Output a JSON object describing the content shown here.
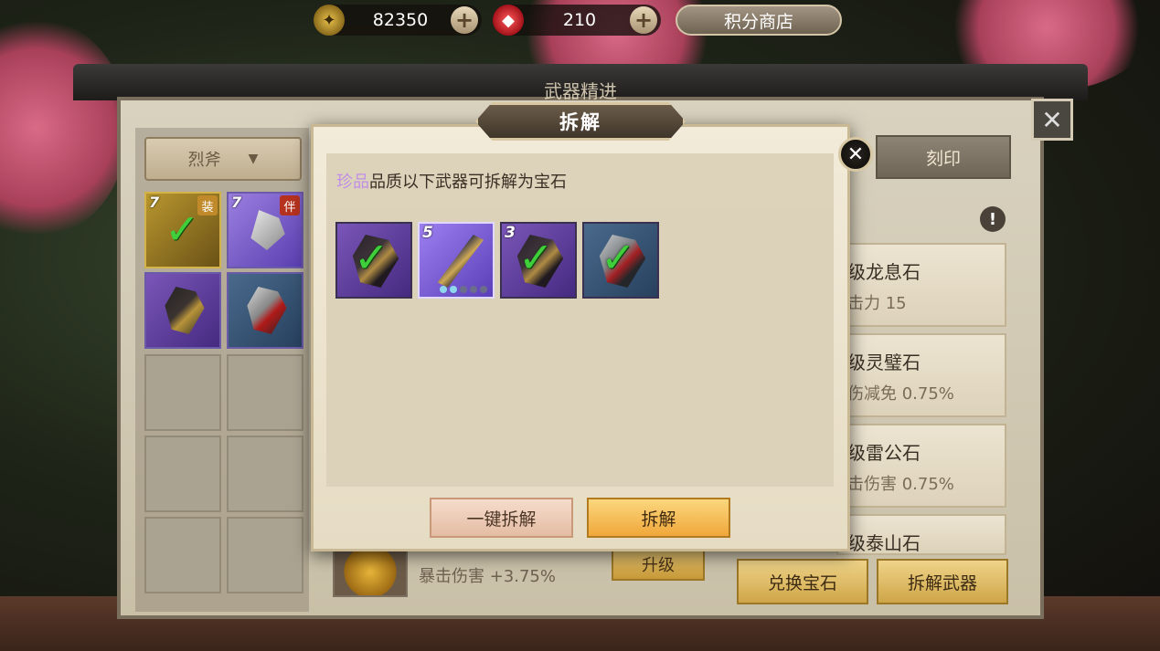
{
  "currency": {
    "gold": {
      "icon": "gold-ticket-icon",
      "value": "82350"
    },
    "gem": {
      "icon": "red-gem-icon",
      "value": "210"
    },
    "shop_label": "积分商店"
  },
  "main_panel": {
    "title": "武器精进",
    "filter_label": "烈斧",
    "tab_imprint": "刻印",
    "inventory": [
      {
        "level": "7",
        "tag": "装",
        "checked": true
      },
      {
        "level": "7",
        "tag": "伴",
        "checked": false
      },
      {
        "level": "",
        "tag": "",
        "checked": false
      },
      {
        "level": "",
        "tag": "",
        "checked": false
      }
    ],
    "gems": [
      {
        "name": "级龙息石",
        "stat": "击力 15"
      },
      {
        "name": "级灵璧石",
        "stat": "伤减免 0.75%"
      },
      {
        "name": "级雷公石",
        "stat": "击伤害 0.75%"
      },
      {
        "name": "级泰山石",
        "stat": ""
      }
    ],
    "bottom_stat": "暴击伤害 +3.75%",
    "upgrade_label": "升级",
    "exchange_label": "兑换宝石",
    "dismantle_weapon_label": "拆解武器"
  },
  "modal": {
    "title": "拆解",
    "hint_highlight": "珍品",
    "hint_text": "品质以下武器可拆解为宝石",
    "weapons": [
      {
        "level": "",
        "quality": "purple",
        "checked": true
      },
      {
        "level": "5",
        "quality": "purple-selected",
        "checked": false
      },
      {
        "level": "3",
        "quality": "purple",
        "checked": true
      },
      {
        "level": "",
        "quality": "blue",
        "checked": true
      }
    ],
    "oneclick_label": "一键拆解",
    "dismantle_label": "拆解"
  }
}
